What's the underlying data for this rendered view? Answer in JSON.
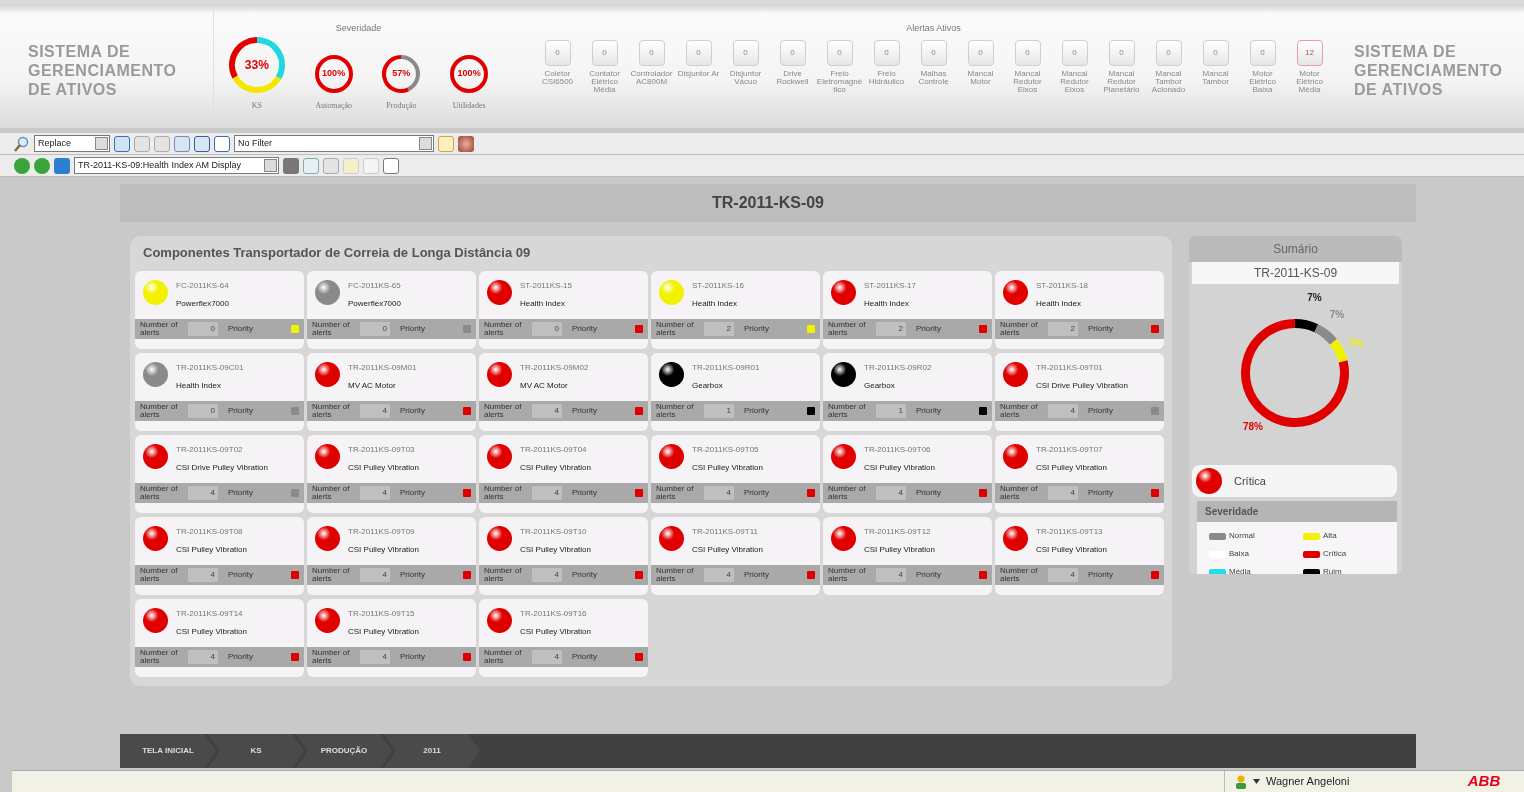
{
  "header": {
    "title_left": "SISTEMA DE GERENCIAMENTO DE ATIVOS",
    "severity_title": "Severidade",
    "gauges": [
      {
        "label": "KS",
        "value": "33%",
        "segments": [
          {
            "color": "#1fd8e0"
          },
          {
            "color": "#f5e600"
          },
          {
            "color": "#e00000"
          }
        ]
      },
      {
        "label": "Automação",
        "value": "100%",
        "segments": [
          {
            "color": "#e00000"
          }
        ]
      },
      {
        "label": "Produção",
        "value": "57%",
        "segments": [
          {
            "color": "#8a8a8a"
          },
          {
            "color": "#e00000"
          }
        ]
      },
      {
        "label": "Utilidades",
        "value": "100%",
        "segments": [
          {
            "color": "#e00000"
          }
        ]
      }
    ],
    "alerts_title": "Alertas Ativos",
    "alerts": [
      {
        "label": "Coletor CSI6500",
        "count": "0",
        "active": false
      },
      {
        "label": "Contator Elétrico Média",
        "count": "0",
        "active": false
      },
      {
        "label": "Controlador AC800M",
        "count": "0",
        "active": false
      },
      {
        "label": "Disjuntor Ar",
        "count": "0",
        "active": false
      },
      {
        "label": "Disjuntor Vácuo",
        "count": "0",
        "active": false
      },
      {
        "label": "Drive Rockwell",
        "count": "0",
        "active": false
      },
      {
        "label": "Freio Eletromagnético",
        "count": "0",
        "active": false
      },
      {
        "label": "Freio Hidráulico",
        "count": "0",
        "active": false
      },
      {
        "label": "Malhas Controle",
        "count": "0",
        "active": false
      },
      {
        "label": "Mancal Motor",
        "count": "0",
        "active": false
      },
      {
        "label": "Mancal Redutor Eixos",
        "count": "0",
        "active": false
      },
      {
        "label": "Mancal Redutor Eixos",
        "count": "0",
        "active": false
      },
      {
        "label": "Mancal Redutor Planetário",
        "count": "0",
        "active": false
      },
      {
        "label": "Mancal Tambor Acionado",
        "count": "0",
        "active": false
      },
      {
        "label": "Mancal Tambor",
        "count": "0",
        "active": false
      },
      {
        "label": "Motor Elétrico Baixa",
        "count": "0",
        "active": false
      },
      {
        "label": "Motor Elétrico Média",
        "count": "12",
        "active": true
      }
    ],
    "title_right": "SISTEMA DE GERENCIAMENTO DE ATIVOS"
  },
  "toolbar": {
    "mode_select": "Replace",
    "filter_select": "No Filter",
    "display_select": "TR-2011-KS-09:Health Index AM Display"
  },
  "page_title": "TR-2011-KS-09",
  "panel": {
    "title": "Componentes Transportador de Correia de Longa Distância 09",
    "cards": [
      {
        "tag": "FC-2011KS-64",
        "type": "Powerflex7000",
        "color": "#f2f200",
        "alerts_label": "Number of alerts",
        "count": "0",
        "priority_label": "Priority",
        "priority": {
          "color": "#f2f200"
        }
      },
      {
        "tag": "FC-2011KS-65",
        "type": "Powerflex7000",
        "color": "#8a8a8a",
        "alerts_label": "Number of alerts",
        "count": "0",
        "priority_label": "Priority",
        "priority": {
          "color": "#8a8a8a"
        }
      },
      {
        "tag": "ST-2011KS-15",
        "type": "Health Index",
        "color": "#e00000",
        "alerts_label": "Number of alerts",
        "count": "0",
        "priority_label": "Priority",
        "priority": {
          "color": "#e00000"
        }
      },
      {
        "tag": "ST-2011KS-16",
        "type": "Health Index",
        "color": "#f2f200",
        "alerts_label": "Number of alerts",
        "count": "2",
        "priority_label": "Priority",
        "priority": {
          "color": "#f2f200"
        }
      },
      {
        "tag": "ST-2011KS-17",
        "type": "Health Index",
        "color": "#e00000",
        "alerts_label": "Number of alerts",
        "count": "2",
        "priority_label": "Priority",
        "priority": {
          "color": "#e00000"
        }
      },
      {
        "tag": "ST-2011KS-18",
        "type": "Health Index",
        "color": "#e00000",
        "alerts_label": "Number of alerts",
        "count": "2",
        "priority_label": "Priority",
        "priority": {
          "color": "#e00000"
        }
      },
      {
        "tag": "TR-2011KS-09C01",
        "type": "Health Index",
        "color": "#8a8a8a",
        "alerts_label": "Number of alerts",
        "count": "0",
        "priority_label": "Priority",
        "priority": {
          "color": "#8a8a8a"
        }
      },
      {
        "tag": "TR-2011KS-09M01",
        "type": "MV AC Motor",
        "color": "#e00000",
        "alerts_label": "Number of alerts",
        "count": "4",
        "priority_label": "Priority",
        "priority": {
          "color": "#e00000"
        }
      },
      {
        "tag": "TR-2011KS-09M02",
        "type": "MV AC Motor",
        "color": "#e00000",
        "alerts_label": "Number of alerts",
        "count": "4",
        "priority_label": "Priority",
        "priority": {
          "color": "#e00000"
        }
      },
      {
        "tag": "TR-2011KS-09R01",
        "type": "Gearbox",
        "color": "#000000",
        "alerts_label": "Number of alerts",
        "count": "1",
        "priority_label": "Priority",
        "priority": {
          "color": "#000000"
        }
      },
      {
        "tag": "TR-2011KS-09R02",
        "type": "Gearbox",
        "color": "#000000",
        "alerts_label": "Number of alerts",
        "count": "1",
        "priority_label": "Priority",
        "priority": {
          "color": "#000000"
        }
      },
      {
        "tag": "TR-2011KS-09T01",
        "type": "CSI Drive Pulley Vibration",
        "color": "#e00000",
        "alerts_label": "Number of alerts",
        "count": "4",
        "priority_label": "Priority",
        "priority": {
          "color": "#8a8a8a"
        }
      },
      {
        "tag": "TR-2011KS-09T02",
        "type": "CSI Drive Pulley Vibration",
        "color": "#e00000",
        "alerts_label": "Number of alerts",
        "count": "4",
        "priority_label": "Priority",
        "priority": {
          "color": "#8a8a8a"
        }
      },
      {
        "tag": "TR-2011KS-09T03",
        "type": "CSI Pulley Vibration",
        "color": "#e00000",
        "alerts_label": "Number of alerts",
        "count": "4",
        "priority_label": "Priority",
        "priority": {
          "color": "#e00000"
        }
      },
      {
        "tag": "TR-2011KS-09T04",
        "type": "CSI Pulley Vibration",
        "color": "#e00000",
        "alerts_label": "Number of alerts",
        "count": "4",
        "priority_label": "Priority",
        "priority": {
          "color": "#e00000"
        }
      },
      {
        "tag": "TR-2011KS-09T05",
        "type": "CSI Pulley Vibration",
        "color": "#e00000",
        "alerts_label": "Number of alerts",
        "count": "4",
        "priority_label": "Priority",
        "priority": {
          "color": "#e00000"
        }
      },
      {
        "tag": "TR-2011KS-09T06",
        "type": "CSI Pulley Vibration",
        "color": "#e00000",
        "alerts_label": "Number of alerts",
        "count": "4",
        "priority_label": "Priority",
        "priority": {
          "color": "#e00000"
        }
      },
      {
        "tag": "TR-2011KS-09T07",
        "type": "CSI Pulley Vibration",
        "color": "#e00000",
        "alerts_label": "Number of alerts",
        "count": "4",
        "priority_label": "Priority",
        "priority": {
          "color": "#e00000"
        }
      },
      {
        "tag": "TR-2011KS-09T08",
        "type": "CSI Pulley Vibration",
        "color": "#e00000",
        "alerts_label": "Number of alerts",
        "count": "4",
        "priority_label": "Priority",
        "priority": {
          "color": "#e00000"
        }
      },
      {
        "tag": "TR-2011KS-09T09",
        "type": "CSI Pulley Vibration",
        "color": "#e00000",
        "alerts_label": "Number of alerts",
        "count": "4",
        "priority_label": "Priority",
        "priority": {
          "color": "#e00000"
        }
      },
      {
        "tag": "TR-2011KS-09T10",
        "type": "CSI Pulley Vibration",
        "color": "#e00000",
        "alerts_label": "Number of alerts",
        "count": "4",
        "priority_label": "Priority",
        "priority": {
          "color": "#e00000"
        }
      },
      {
        "tag": "TR-2011KS-09T11",
        "type": "CSI Pulley Vibration",
        "color": "#e00000",
        "alerts_label": "Number of alerts",
        "count": "4",
        "priority_label": "Priority",
        "priority": {
          "color": "#e00000"
        }
      },
      {
        "tag": "TR-2011KS-09T12",
        "type": "CSI Pulley Vibration",
        "color": "#e00000",
        "alerts_label": "Number of alerts",
        "count": "4",
        "priority_label": "Priority",
        "priority": {
          "color": "#e00000"
        }
      },
      {
        "tag": "TR-2011KS-09T13",
        "type": "CSI Pulley Vibration",
        "color": "#e00000",
        "alerts_label": "Number of alerts",
        "count": "4",
        "priority_label": "Priority",
        "priority": {
          "color": "#e00000"
        }
      },
      {
        "tag": "TR-2011KS-09T14",
        "type": "CSI Pulley Vibration",
        "color": "#e00000",
        "alerts_label": "Number of alerts",
        "count": "4",
        "priority_label": "Priority",
        "priority": {
          "color": "#e00000"
        }
      },
      {
        "tag": "TR-2011KS-09T15",
        "type": "CSI Pulley Vibration",
        "color": "#e00000",
        "alerts_label": "Number of alerts",
        "count": "4",
        "priority_label": "Priority",
        "priority": {
          "color": "#e00000"
        }
      },
      {
        "tag": "TR-2011KS-09T16",
        "type": "CSI Pulley Vibration",
        "color": "#e00000",
        "alerts_label": "Number of alerts",
        "count": "4",
        "priority_label": "Priority",
        "priority": {
          "color": "#e00000"
        }
      }
    ]
  },
  "summary": {
    "title": "Sumário",
    "asset": "TR-2011-KS-09",
    "segments": [
      {
        "label": "7%",
        "color": "#000000"
      },
      {
        "label": "7%",
        "color": "#8a8a8a"
      },
      {
        "label": "7%",
        "color": "#f2f200"
      },
      {
        "label": "78%",
        "color": "#e00000"
      }
    ],
    "status": {
      "label": "Crítica",
      "color": "#e00000"
    },
    "legend_title": "Severidade",
    "legend": [
      {
        "label": "Normal",
        "color": "#8a8a8a"
      },
      {
        "label": "Alta",
        "color": "#f2f200"
      },
      {
        "label": "Baixa",
        "color": "#ffffff"
      },
      {
        "label": "Crítica",
        "color": "#e00000"
      },
      {
        "label": "Média",
        "color": "#1fe0ea"
      },
      {
        "label": "Ruim",
        "color": "#000000"
      }
    ]
  },
  "breadcrumb": [
    "TELA INICIAL",
    "KS",
    "PRODUÇÃO",
    "2011"
  ],
  "status_bar": {
    "user": "Wagner Angeloni",
    "logo": "ABB"
  }
}
